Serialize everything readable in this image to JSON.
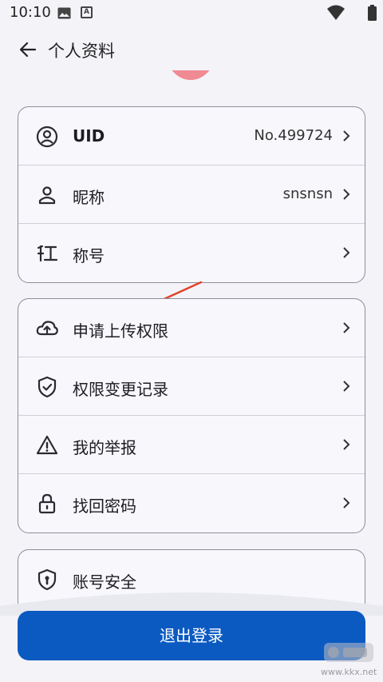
{
  "status_bar": {
    "time": "10:10",
    "notification_icon_letter": "A"
  },
  "appbar": {
    "title": "个人资料"
  },
  "profile_card": {
    "rows": [
      {
        "label": "UID",
        "value": "No.499724",
        "icon": "user-circle-icon"
      },
      {
        "label": "昵称",
        "value": "snsnsn",
        "icon": "person-icon"
      },
      {
        "label": "称号",
        "value": "",
        "icon": "title-icon"
      }
    ]
  },
  "permission_card": {
    "rows": [
      {
        "label": "申请上传权限",
        "icon": "cloud-upload-icon"
      },
      {
        "label": "权限变更记录",
        "icon": "shield-check-icon"
      },
      {
        "label": "我的举报",
        "icon": "warning-icon"
      },
      {
        "label": "找回密码",
        "icon": "lock-icon"
      }
    ]
  },
  "security_card": {
    "rows": [
      {
        "label": "账号安全",
        "icon": "shield-keyhole-icon"
      }
    ]
  },
  "logout_button": {
    "label": "退出登录"
  },
  "watermark": {
    "text": "www.kkx.net"
  },
  "colors": {
    "primary": "#0b5ac2",
    "annotation_arrow": "#e0432a",
    "avatar": "#f08a93"
  }
}
